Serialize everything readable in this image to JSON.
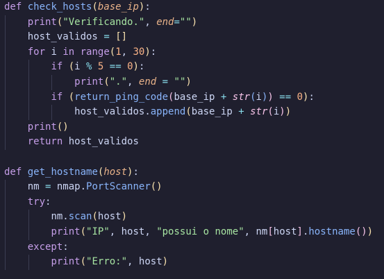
{
  "colors": {
    "background": "#1f1f2e",
    "indent_guide": "#3b3d52",
    "keyword": "#c59ee8",
    "function": "#89b4fa",
    "parameter": "#e8b289",
    "string": "#a6e3a1",
    "number": "#fab387",
    "operator": "#89dceb",
    "builtin": "#f5c2e7",
    "bracket": "#f9e2af",
    "plain": "#cdd6f4"
  },
  "lines": [
    {
      "indent": 0,
      "tokens": [
        {
          "t": "def",
          "k": "keyword"
        },
        {
          "t": " ",
          "k": "plain"
        },
        {
          "t": "check_hosts",
          "k": "function"
        },
        {
          "t": "(",
          "k": "bracket"
        },
        {
          "t": "base_ip",
          "k": "parameter",
          "italic": true
        },
        {
          "t": ")",
          "k": "bracket"
        },
        {
          "t": ":",
          "k": "plain"
        }
      ]
    },
    {
      "indent": 1,
      "tokens": [
        {
          "t": "print",
          "k": "keyword"
        },
        {
          "t": "(",
          "k": "bracket"
        },
        {
          "t": "\"Verificando.\"",
          "k": "string"
        },
        {
          "t": ", ",
          "k": "plain"
        },
        {
          "t": "end",
          "k": "parameter",
          "italic": true
        },
        {
          "t": "=",
          "k": "operator"
        },
        {
          "t": "\"\"",
          "k": "string"
        },
        {
          "t": ")",
          "k": "bracket"
        }
      ]
    },
    {
      "indent": 1,
      "tokens": [
        {
          "t": "host_validos",
          "k": "plain"
        },
        {
          "t": " ",
          "k": "plain"
        },
        {
          "t": "=",
          "k": "operator"
        },
        {
          "t": " ",
          "k": "plain"
        },
        {
          "t": "[]",
          "k": "bracket"
        }
      ]
    },
    {
      "indent": 1,
      "tokens": [
        {
          "t": "for",
          "k": "keyword"
        },
        {
          "t": " i ",
          "k": "plain"
        },
        {
          "t": "in",
          "k": "keyword"
        },
        {
          "t": " ",
          "k": "plain"
        },
        {
          "t": "range",
          "k": "keyword"
        },
        {
          "t": "(",
          "k": "bracket"
        },
        {
          "t": "1",
          "k": "number"
        },
        {
          "t": ", ",
          "k": "plain"
        },
        {
          "t": "30",
          "k": "number"
        },
        {
          "t": ")",
          "k": "bracket"
        },
        {
          "t": ":",
          "k": "plain"
        }
      ]
    },
    {
      "indent": 2,
      "tokens": [
        {
          "t": "if",
          "k": "keyword"
        },
        {
          "t": " ",
          "k": "plain"
        },
        {
          "t": "(",
          "k": "bracket"
        },
        {
          "t": "i ",
          "k": "plain"
        },
        {
          "t": "%",
          "k": "operator"
        },
        {
          "t": " ",
          "k": "plain"
        },
        {
          "t": "5",
          "k": "number"
        },
        {
          "t": " ",
          "k": "plain"
        },
        {
          "t": "==",
          "k": "operator"
        },
        {
          "t": " ",
          "k": "plain"
        },
        {
          "t": "0",
          "k": "number"
        },
        {
          "t": ")",
          "k": "bracket"
        },
        {
          "t": ":",
          "k": "plain"
        }
      ]
    },
    {
      "indent": 3,
      "tokens": [
        {
          "t": "print",
          "k": "keyword"
        },
        {
          "t": "(",
          "k": "bracket"
        },
        {
          "t": "\".\"",
          "k": "string"
        },
        {
          "t": ", ",
          "k": "plain"
        },
        {
          "t": "end",
          "k": "parameter",
          "italic": true
        },
        {
          "t": " ",
          "k": "plain"
        },
        {
          "t": "=",
          "k": "operator"
        },
        {
          "t": " ",
          "k": "plain"
        },
        {
          "t": "\"\"",
          "k": "string"
        },
        {
          "t": ")",
          "k": "bracket"
        }
      ]
    },
    {
      "indent": 2,
      "tokens": [
        {
          "t": "if",
          "k": "keyword"
        },
        {
          "t": " ",
          "k": "plain"
        },
        {
          "t": "(",
          "k": "bracket"
        },
        {
          "t": "return_ping_code",
          "k": "function"
        },
        {
          "t": "(",
          "k": "builtin"
        },
        {
          "t": "base_ip",
          "k": "plain"
        },
        {
          "t": " ",
          "k": "plain"
        },
        {
          "t": "+",
          "k": "operator"
        },
        {
          "t": " ",
          "k": "plain"
        },
        {
          "t": "str",
          "k": "builtin",
          "italic": true
        },
        {
          "t": "(",
          "k": "function"
        },
        {
          "t": "i",
          "k": "plain"
        },
        {
          "t": ")",
          "k": "function"
        },
        {
          "t": ")",
          "k": "builtin"
        },
        {
          "t": " ",
          "k": "plain"
        },
        {
          "t": "==",
          "k": "operator"
        },
        {
          "t": " ",
          "k": "plain"
        },
        {
          "t": "0",
          "k": "number"
        },
        {
          "t": ")",
          "k": "bracket"
        },
        {
          "t": ":",
          "k": "plain"
        }
      ]
    },
    {
      "indent": 3,
      "tokens": [
        {
          "t": "host_validos",
          "k": "plain"
        },
        {
          "t": ".",
          "k": "plain"
        },
        {
          "t": "append",
          "k": "function"
        },
        {
          "t": "(",
          "k": "bracket"
        },
        {
          "t": "base_ip",
          "k": "plain"
        },
        {
          "t": " ",
          "k": "plain"
        },
        {
          "t": "+",
          "k": "operator"
        },
        {
          "t": " ",
          "k": "plain"
        },
        {
          "t": "str",
          "k": "builtin",
          "italic": true
        },
        {
          "t": "(",
          "k": "builtin"
        },
        {
          "t": "i",
          "k": "plain"
        },
        {
          "t": ")",
          "k": "builtin"
        },
        {
          "t": ")",
          "k": "bracket"
        }
      ]
    },
    {
      "indent": 1,
      "tokens": [
        {
          "t": "print",
          "k": "keyword"
        },
        {
          "t": "()",
          "k": "bracket"
        }
      ]
    },
    {
      "indent": 1,
      "tokens": [
        {
          "t": "return",
          "k": "keyword"
        },
        {
          "t": " host_validos",
          "k": "plain"
        }
      ]
    },
    {
      "indent": 0,
      "tokens": []
    },
    {
      "indent": 0,
      "tokens": [
        {
          "t": "def",
          "k": "keyword"
        },
        {
          "t": " ",
          "k": "plain"
        },
        {
          "t": "get_hostname",
          "k": "function"
        },
        {
          "t": "(",
          "k": "bracket"
        },
        {
          "t": "host",
          "k": "parameter",
          "italic": true
        },
        {
          "t": ")",
          "k": "bracket"
        },
        {
          "t": ":",
          "k": "plain"
        }
      ]
    },
    {
      "indent": 1,
      "tokens": [
        {
          "t": "nm",
          "k": "plain"
        },
        {
          "t": " ",
          "k": "plain"
        },
        {
          "t": "=",
          "k": "operator"
        },
        {
          "t": " nmap.",
          "k": "plain"
        },
        {
          "t": "PortScanner",
          "k": "function"
        },
        {
          "t": "()",
          "k": "bracket"
        }
      ]
    },
    {
      "indent": 1,
      "tokens": [
        {
          "t": "try",
          "k": "keyword"
        },
        {
          "t": ":",
          "k": "plain"
        }
      ]
    },
    {
      "indent": 2,
      "tokens": [
        {
          "t": "nm.",
          "k": "plain"
        },
        {
          "t": "scan",
          "k": "function"
        },
        {
          "t": "(",
          "k": "bracket"
        },
        {
          "t": "host",
          "k": "plain"
        },
        {
          "t": ")",
          "k": "bracket"
        }
      ]
    },
    {
      "indent": 2,
      "tokens": [
        {
          "t": "print",
          "k": "keyword"
        },
        {
          "t": "(",
          "k": "bracket"
        },
        {
          "t": "\"IP\"",
          "k": "string"
        },
        {
          "t": ", host, ",
          "k": "plain"
        },
        {
          "t": "\"possui o nome\"",
          "k": "string"
        },
        {
          "t": ", nm",
          "k": "plain"
        },
        {
          "t": "[",
          "k": "builtin"
        },
        {
          "t": "host",
          "k": "plain"
        },
        {
          "t": "]",
          "k": "builtin"
        },
        {
          "t": ".",
          "k": "plain"
        },
        {
          "t": "hostname",
          "k": "function"
        },
        {
          "t": "()",
          "k": "builtin"
        },
        {
          "t": ")",
          "k": "bracket"
        }
      ]
    },
    {
      "indent": 1,
      "tokens": [
        {
          "t": "except",
          "k": "keyword"
        },
        {
          "t": ":",
          "k": "plain"
        }
      ]
    },
    {
      "indent": 2,
      "tokens": [
        {
          "t": "print",
          "k": "keyword"
        },
        {
          "t": "(",
          "k": "bracket"
        },
        {
          "t": "\"Erro:\"",
          "k": "string"
        },
        {
          "t": ", host",
          "k": "plain"
        },
        {
          "t": ")",
          "k": "bracket"
        }
      ]
    }
  ]
}
